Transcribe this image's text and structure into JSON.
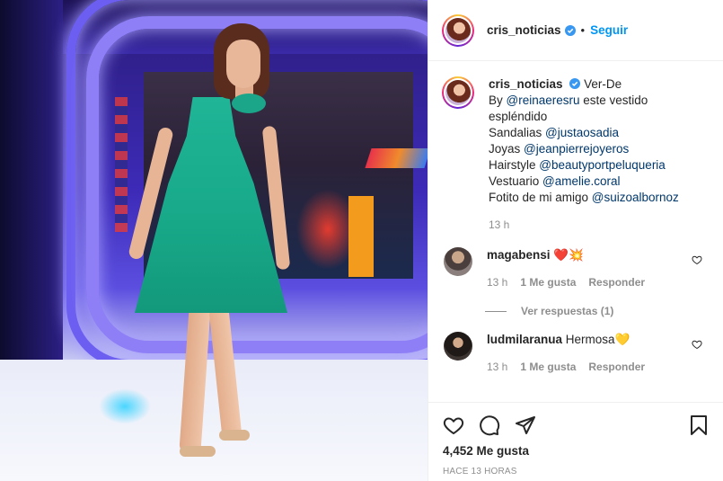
{
  "header": {
    "username": "cris_noticias",
    "separator": "•",
    "follow_label": "Seguir"
  },
  "caption": {
    "username": "cris_noticias",
    "text_after_name": "Ver-De",
    "lines": [
      {
        "prefix": "By ",
        "mention": "@reinaeresru",
        "suffix": " este vestido espléndido"
      },
      {
        "prefix": "Sandalias ",
        "mention": "@justaosadia",
        "suffix": ""
      },
      {
        "prefix": "Joyas ",
        "mention": "@jeanpierrejoyeros",
        "suffix": ""
      },
      {
        "prefix": "Hairstyle ",
        "mention": "@beautyportpeluqueria",
        "suffix": ""
      },
      {
        "prefix": "Vestuario ",
        "mention": "@amelie.coral",
        "suffix": ""
      },
      {
        "prefix": "Fotito de mi amigo ",
        "mention": "@suizoalbornoz",
        "suffix": ""
      }
    ],
    "time": "13 h"
  },
  "comments": [
    {
      "username": "magabensi",
      "text": "❤️💥",
      "time": "13 h",
      "likes": "1 Me gusta",
      "reply": "Responder",
      "view_replies": "Ver respuestas (1)"
    },
    {
      "username": "ludmilaranua",
      "text": "Hermosa💛",
      "time": "13 h",
      "likes": "1 Me gusta",
      "reply": "Responder"
    }
  ],
  "actions": {
    "icons": [
      "heart-icon",
      "comment-icon",
      "share-icon",
      "bookmark-icon"
    ],
    "likes": "4,452 Me gusta",
    "timestamp": "HACE 13 HORAS"
  },
  "colors": {
    "follow": "#0095f6",
    "mention": "#00376b",
    "dress": "#1fb596"
  }
}
